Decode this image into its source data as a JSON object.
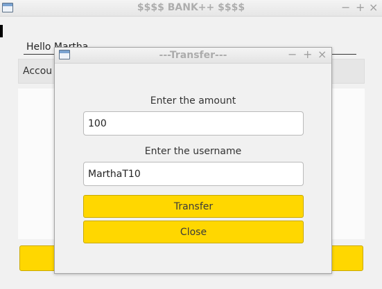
{
  "main_window": {
    "title": "$$$$ BANK++ $$$$",
    "controls": {
      "minimize": "−",
      "maximize": "+",
      "close": "×"
    },
    "greeting": "Hello Martha",
    "accounts_header": "Accou"
  },
  "transfer_dialog": {
    "title": "---Transfer---",
    "controls": {
      "minimize": "−",
      "maximize": "+",
      "close": "×"
    },
    "amount_label": "Enter the amount",
    "amount_value": "100",
    "username_label": "Enter the username",
    "username_value": "MarthaT10",
    "transfer_button": "Transfer",
    "close_button": "Close"
  },
  "colors": {
    "button_yellow": "#ffd700",
    "window_background": "#f1f1f1"
  },
  "icons": [
    "window-icon",
    "minimize-icon",
    "maximize-icon",
    "close-icon"
  ]
}
